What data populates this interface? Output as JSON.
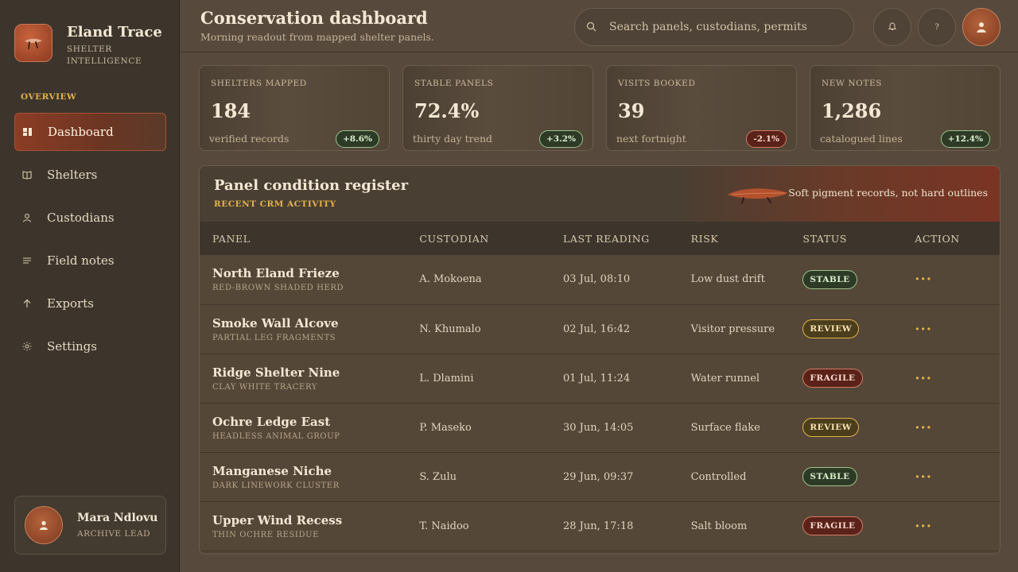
{
  "brand": {
    "name": "Eland Trace",
    "subtitle": "SHELTER INTELLIGENCE"
  },
  "sidebar": {
    "section": "OVERVIEW",
    "items": [
      {
        "label": "Dashboard",
        "icon": "dashboard-icon",
        "active": true
      },
      {
        "label": "Shelters",
        "icon": "book-icon"
      },
      {
        "label": "Custodians",
        "icon": "person-icon"
      },
      {
        "label": "Field notes",
        "icon": "lines-icon"
      },
      {
        "label": "Exports",
        "icon": "arrow-up-icon"
      },
      {
        "label": "Settings",
        "icon": "sun-gear-icon"
      }
    ],
    "user": {
      "name": "Mara Ndlovu",
      "role": "ARCHIVE LEAD"
    }
  },
  "header": {
    "title": "Conservation dashboard",
    "subtitle": "Morning readout from mapped shelter panels.",
    "search_placeholder": "Search panels, custodians, permits",
    "help_label": "?"
  },
  "stats": [
    {
      "label": "SHELTERS MAPPED",
      "value": "184",
      "note": "verified records",
      "delta": "+8.6%",
      "trend": "up"
    },
    {
      "label": "STABLE PANELS",
      "value": "72.4%",
      "note": "thirty day trend",
      "delta": "+3.2%",
      "trend": "up"
    },
    {
      "label": "VISITS BOOKED",
      "value": "39",
      "note": "next fortnight",
      "delta": "-2.1%",
      "trend": "down"
    },
    {
      "label": "NEW NOTES",
      "value": "1,286",
      "note": "catalogued lines",
      "delta": "+12.4%",
      "trend": "up"
    }
  ],
  "register": {
    "title": "Panel condition register",
    "subtitle": "RECENT CRM ACTIVITY",
    "note": "Soft pigment records, not hard outlines",
    "columns": [
      "PANEL",
      "CUSTODIAN",
      "LAST READING",
      "RISK",
      "STATUS",
      "ACTION"
    ],
    "rows": [
      {
        "panel": "North Eland Frieze",
        "desc": "RED-BROWN SHADED HERD",
        "custodian": "A. Mokoena",
        "reading": "03 Jul, 08:10",
        "risk": "Low dust drift",
        "status": "STABLE",
        "action": "···"
      },
      {
        "panel": "Smoke Wall Alcove",
        "desc": "PARTIAL LEG FRAGMENTS",
        "custodian": "N. Khumalo",
        "reading": "02 Jul, 16:42",
        "risk": "Visitor pressure",
        "status": "REVIEW",
        "action": "···"
      },
      {
        "panel": "Ridge Shelter Nine",
        "desc": "CLAY WHITE TRACERY",
        "custodian": "L. Dlamini",
        "reading": "01 Jul, 11:24",
        "risk": "Water runnel",
        "status": "FRAGILE",
        "action": "···"
      },
      {
        "panel": "Ochre Ledge East",
        "desc": "HEADLESS ANIMAL GROUP",
        "custodian": "P. Maseko",
        "reading": "30 Jun, 14:05",
        "risk": "Surface flake",
        "status": "REVIEW",
        "action": "···"
      },
      {
        "panel": "Manganese Niche",
        "desc": "DARK LINEWORK CLUSTER",
        "custodian": "S. Zulu",
        "reading": "29 Jun, 09:37",
        "risk": "Controlled",
        "status": "STABLE",
        "action": "···"
      },
      {
        "panel": "Upper Wind Recess",
        "desc": "THIN OCHRE RESIDUE",
        "custodian": "T. Naidoo",
        "reading": "28 Jun, 17:18",
        "risk": "Salt bloom",
        "status": "FRAGILE",
        "action": "···"
      }
    ]
  }
}
